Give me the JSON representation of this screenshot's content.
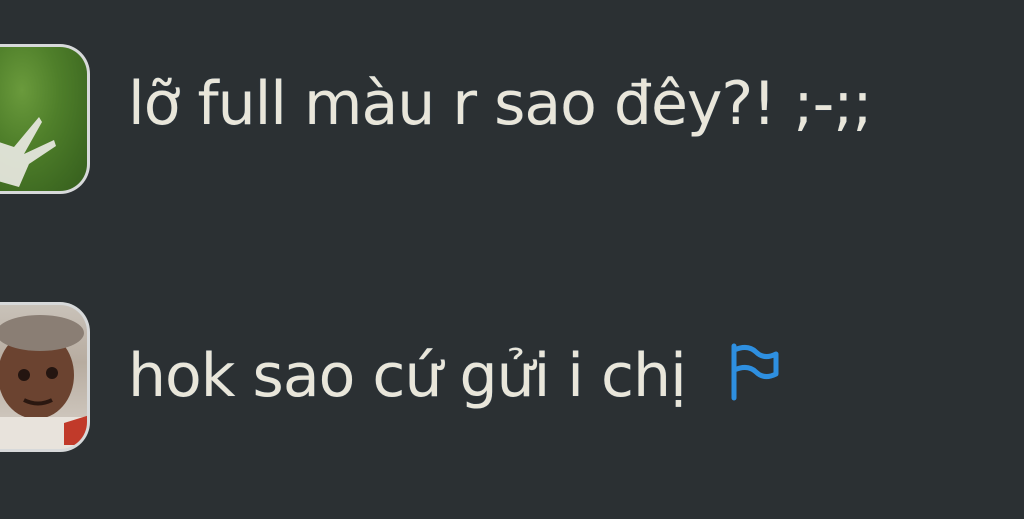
{
  "messages": [
    {
      "avatar": "grass-antler-avatar",
      "text": "lỡ full màu r sao đêy?! ;-;;"
    },
    {
      "avatar": "person-face-avatar",
      "text": "hok sao cứ gửi i chị",
      "flag_icon": "flag-icon"
    }
  ],
  "colors": {
    "background": "#2b3033",
    "text": "#e9e6da",
    "flag": "#2e8fe0",
    "avatar_border": "#d7d9da"
  }
}
